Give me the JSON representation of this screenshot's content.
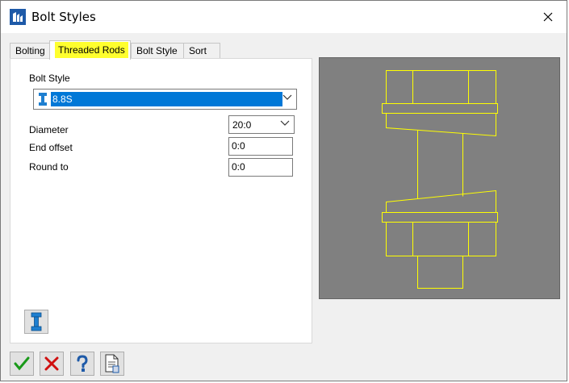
{
  "window": {
    "title": "Bolt Styles"
  },
  "tabs": [
    {
      "label": "Bolting"
    },
    {
      "label": "Threaded Rods",
      "active": true
    },
    {
      "label": "Bolt Style"
    },
    {
      "label": "Sort"
    }
  ],
  "form": {
    "bolt_style_label": "Bolt Style",
    "bolt_style_value": "8.8S",
    "diameter_label": "Diameter",
    "diameter_value": "20:0",
    "end_offset_label": "End offset",
    "end_offset_value": "0:0",
    "round_to_label": "Round to",
    "round_to_value": "0:0"
  },
  "colors": {
    "selection": "#0078d7",
    "highlight": "#ffff2e",
    "preview_bg": "#808080",
    "preview_lines": "#ffff00"
  },
  "icons": {
    "app": "app-logo-icon",
    "close": "close-icon",
    "bolt": "bolt-icon",
    "ok": "checkmark-icon",
    "cancel": "cancel-x-icon",
    "help": "help-question-icon",
    "document": "document-icon"
  }
}
